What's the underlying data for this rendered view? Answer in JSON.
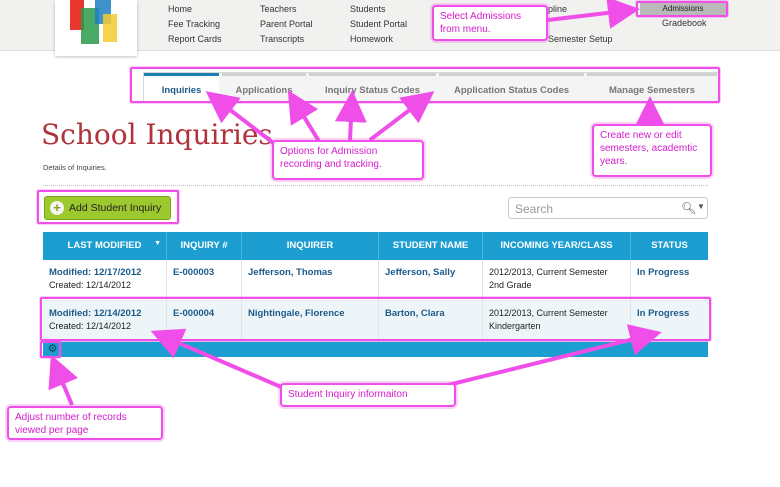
{
  "nav": {
    "col1": [
      "Home",
      "Fee Tracking",
      "Report Cards"
    ],
    "col2": [
      "Teachers",
      "Parent Portal",
      "Transcripts"
    ],
    "col3": [
      "Students",
      "Student Portal",
      "Homework"
    ],
    "col4": [
      "pline",
      "Semester Setup"
    ],
    "active_item": "Admissions",
    "gradebook": "Gradebook"
  },
  "tabs": [
    "Inquiries",
    "Applications",
    "Inquiry Status Codes",
    "Application Status Codes",
    "Manage Semesters"
  ],
  "page": {
    "title": "School Inquiries",
    "subtitle": "Details of Inquiries.",
    "add_button": "Add Student Inquiry",
    "search_placeholder": "Search"
  },
  "table": {
    "headers": [
      "LAST MODIFIED",
      "INQUIRY #",
      "INQUIRER",
      "STUDENT NAME",
      "INCOMING YEAR/CLASS",
      "STATUS"
    ],
    "rows": [
      {
        "modified": "Modified: 12/17/2012",
        "created": "Created: 12/14/2012",
        "inquiry": "E-000003",
        "inquirer": "Jefferson, Thomas",
        "student": "Jefferson, Sally",
        "year_line1": "2012/2013, Current Semester",
        "year_line2": "2nd Grade",
        "status": "In Progress"
      },
      {
        "modified": "Modified: 12/14/2012",
        "created": "Created: 12/14/2012",
        "inquiry": "E-000004",
        "inquirer": "Nightingale, Florence",
        "student": "Barton, Clara",
        "year_line1": "2012/2013, Current Semester",
        "year_line2": "Kindergarten",
        "status": "In Progress"
      }
    ]
  },
  "callouts": {
    "select_admissions": "Select Admissions from menu.",
    "options": "Options for Admission recording and tracking.",
    "semesters": "Create new or edit semesters, academtic years.",
    "student_info": "Student Inquiry informaiton",
    "records": "Adjust number of records viewed per page"
  },
  "icons": {
    "add": "plus-circle-icon",
    "search": "magnifier-icon",
    "dropdown": "caret-down-icon",
    "settings": "gear-icon",
    "sort": "sort-desc-icon"
  },
  "colors": {
    "accent_blue": "#1c9ed0",
    "title_red": "#b0323a",
    "button_green": "#9cc92e",
    "annotation_magenta": "#ef4ee8"
  }
}
